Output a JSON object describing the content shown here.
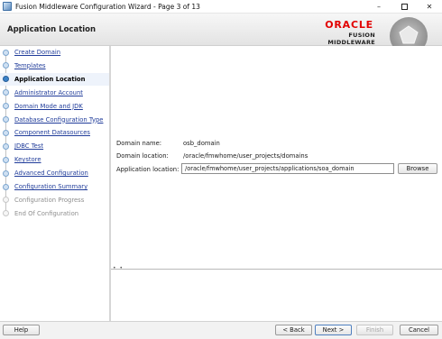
{
  "window": {
    "title": "Fusion Middleware Configuration Wizard - Page 3 of 13",
    "minimize_glyph": "–",
    "close_glyph": "✕"
  },
  "header": {
    "title": "Application Location",
    "logo_word": "ORACLE",
    "logo_sub": "FUSION MIDDLEWARE"
  },
  "nav": {
    "items": [
      {
        "label": "Create Domain",
        "state": "done"
      },
      {
        "label": "Templates",
        "state": "done"
      },
      {
        "label": "Application Location",
        "state": "current"
      },
      {
        "label": "Administrator Account",
        "state": "done"
      },
      {
        "label": "Domain Mode and JDK",
        "state": "done"
      },
      {
        "label": "Database Configuration Type",
        "state": "done"
      },
      {
        "label": "Component Datasources",
        "state": "done"
      },
      {
        "label": "JDBC Test",
        "state": "done"
      },
      {
        "label": "Keystore",
        "state": "done"
      },
      {
        "label": "Advanced Configuration",
        "state": "done"
      },
      {
        "label": "Configuration Summary",
        "state": "done"
      },
      {
        "label": "Configuration Progress",
        "state": "pending"
      },
      {
        "label": "End Of Configuration",
        "state": "pending"
      }
    ]
  },
  "form": {
    "domain_name_label": "Domain name:",
    "domain_name_value": "osb_domain",
    "domain_location_label": "Domain location:",
    "domain_location_value": "/oracle/fmwhome/user_projects/domains",
    "app_location_label": "Application location:",
    "app_location_value": "/oracle/fmwhome/user_projects/applications/soa_domain",
    "browse_label": "Browse"
  },
  "footer": {
    "help_label": "Help",
    "back_label": "< Back",
    "next_label": "Next >",
    "finish_label": "Finish",
    "cancel_label": "Cancel"
  },
  "colors": {
    "oracle_red": "#e20000",
    "link_blue": "#203c9a",
    "current_step": "#3c82c8"
  }
}
